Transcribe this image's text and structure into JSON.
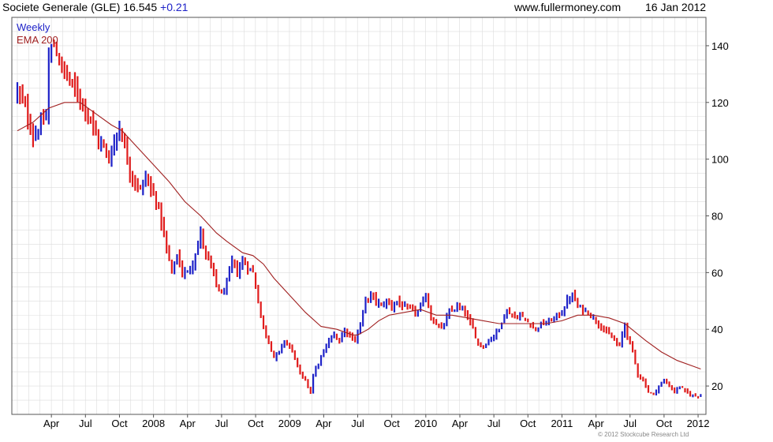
{
  "header": {
    "ticker": "Societe Generale (GLE) 16.545",
    "change": "+0.21",
    "site": "www.fullermoney.com",
    "date": "16 Jan 2012"
  },
  "footer": {
    "copyright": "© 2012 Stockcube Research Ltd"
  },
  "colors": {
    "up": "#1e22c8",
    "down": "#e01b1b",
    "ema": "#a02020",
    "grid": "#dcdcdc",
    "axis": "#555555"
  },
  "chart_data": {
    "type": "candlestick",
    "title": "Societe Generale (GLE) 16.545 +0.21",
    "legend": [
      {
        "name": "Weekly",
        "color": "#1e22c8"
      },
      {
        "name": "EMA 200",
        "color": "#a02020"
      }
    ],
    "legend_position": "top-left",
    "grid": true,
    "y_axis": {
      "side": "right",
      "ylim": [
        10,
        150
      ],
      "ticks": [
        20,
        40,
        60,
        80,
        100,
        120,
        140
      ]
    },
    "x_axis": {
      "labels": [
        "Apr",
        "Jul",
        "Oct",
        "2008",
        "Apr",
        "Jul",
        "Oct",
        "2009",
        "Apr",
        "Jul",
        "Oct",
        "2010",
        "Apr",
        "Jul",
        "Oct",
        "2011",
        "Apr",
        "Jul",
        "Oct",
        "2012"
      ],
      "label_weeks": [
        13,
        26,
        39,
        52,
        65,
        78,
        91,
        104,
        117,
        130,
        143,
        156,
        169,
        182,
        195,
        208,
        221,
        234,
        247,
        260
      ]
    },
    "close_path": [
      [
        0,
        124
      ],
      [
        3,
        118
      ],
      [
        6,
        108
      ],
      [
        9,
        112
      ],
      [
        11,
        115
      ],
      [
        12,
        136
      ],
      [
        14,
        140
      ],
      [
        16,
        135
      ],
      [
        18,
        130
      ],
      [
        20,
        128
      ],
      [
        22,
        124
      ],
      [
        24,
        122
      ],
      [
        26,
        118
      ],
      [
        28,
        114
      ],
      [
        30,
        108
      ],
      [
        33,
        104
      ],
      [
        35,
        100
      ],
      [
        37,
        106
      ],
      [
        39,
        112
      ],
      [
        41,
        104
      ],
      [
        43,
        96
      ],
      [
        45,
        92
      ],
      [
        47,
        89
      ],
      [
        49,
        94
      ],
      [
        51,
        89
      ],
      [
        53,
        86
      ],
      [
        55,
        78
      ],
      [
        57,
        68
      ],
      [
        59,
        60
      ],
      [
        61,
        66
      ],
      [
        63,
        60
      ],
      [
        65,
        60
      ],
      [
        67,
        64
      ],
      [
        69,
        70
      ],
      [
        70,
        74
      ],
      [
        72,
        66
      ],
      [
        74,
        62
      ],
      [
        76,
        56
      ],
      [
        78,
        52
      ],
      [
        80,
        56
      ],
      [
        82,
        64
      ],
      [
        84,
        60
      ],
      [
        86,
        64
      ],
      [
        88,
        62
      ],
      [
        90,
        60
      ],
      [
        92,
        50
      ],
      [
        94,
        40
      ],
      [
        96,
        36
      ],
      [
        98,
        30
      ],
      [
        100,
        32
      ],
      [
        102,
        36
      ],
      [
        104,
        34
      ],
      [
        106,
        30
      ],
      [
        108,
        24
      ],
      [
        110,
        22
      ],
      [
        112,
        18
      ],
      [
        113,
        24
      ],
      [
        115,
        28
      ],
      [
        117,
        32
      ],
      [
        119,
        36
      ],
      [
        121,
        38
      ],
      [
        123,
        36
      ],
      [
        125,
        40
      ],
      [
        127,
        38
      ],
      [
        129,
        36
      ],
      [
        131,
        42
      ],
      [
        133,
        50
      ],
      [
        135,
        52
      ],
      [
        137,
        50
      ],
      [
        139,
        48
      ],
      [
        141,
        50
      ],
      [
        143,
        48
      ],
      [
        145,
        50
      ],
      [
        147,
        48
      ],
      [
        150,
        47
      ],
      [
        153,
        46
      ],
      [
        156,
        52
      ],
      [
        158,
        44
      ],
      [
        160,
        42
      ],
      [
        162,
        40
      ],
      [
        165,
        46
      ],
      [
        168,
        48
      ],
      [
        171,
        46
      ],
      [
        174,
        40
      ],
      [
        176,
        35
      ],
      [
        178,
        34
      ],
      [
        180,
        36
      ],
      [
        182,
        38
      ],
      [
        184,
        40
      ],
      [
        186,
        46
      ],
      [
        188,
        46
      ],
      [
        190,
        44
      ],
      [
        192,
        45
      ],
      [
        194,
        43
      ],
      [
        196,
        42
      ],
      [
        198,
        40
      ],
      [
        200,
        42
      ],
      [
        202,
        42
      ],
      [
        205,
        44
      ],
      [
        208,
        46
      ],
      [
        210,
        50
      ],
      [
        212,
        52
      ],
      [
        214,
        48
      ],
      [
        216,
        47
      ],
      [
        218,
        46
      ],
      [
        220,
        44
      ],
      [
        222,
        42
      ],
      [
        224,
        40
      ],
      [
        226,
        38
      ],
      [
        228,
        36
      ],
      [
        230,
        34
      ],
      [
        232,
        42
      ],
      [
        233,
        38
      ],
      [
        235,
        32
      ],
      [
        237,
        24
      ],
      [
        239,
        22
      ],
      [
        241,
        18
      ],
      [
        243,
        17
      ],
      [
        245,
        20
      ],
      [
        247,
        22
      ],
      [
        249,
        20
      ],
      [
        251,
        18
      ],
      [
        253,
        20
      ],
      [
        255,
        18
      ],
      [
        257,
        17
      ],
      [
        259,
        16.5
      ],
      [
        261,
        16.545
      ]
    ],
    "ema_200": [
      [
        0,
        110
      ],
      [
        6,
        113
      ],
      [
        12,
        118
      ],
      [
        18,
        120
      ],
      [
        24,
        120
      ],
      [
        30,
        116
      ],
      [
        36,
        112
      ],
      [
        40,
        110
      ],
      [
        46,
        104
      ],
      [
        52,
        98
      ],
      [
        58,
        92
      ],
      [
        64,
        85
      ],
      [
        70,
        80
      ],
      [
        76,
        74
      ],
      [
        80,
        71
      ],
      [
        86,
        67
      ],
      [
        90,
        66
      ],
      [
        94,
        63
      ],
      [
        98,
        58
      ],
      [
        104,
        52
      ],
      [
        110,
        46
      ],
      [
        116,
        41
      ],
      [
        122,
        40
      ],
      [
        128,
        38
      ],
      [
        130,
        38
      ],
      [
        134,
        40
      ],
      [
        138,
        43
      ],
      [
        142,
        45
      ],
      [
        148,
        46
      ],
      [
        154,
        47
      ],
      [
        160,
        45
      ],
      [
        166,
        45
      ],
      [
        172,
        44
      ],
      [
        178,
        43
      ],
      [
        184,
        42
      ],
      [
        190,
        42
      ],
      [
        196,
        42
      ],
      [
        202,
        42
      ],
      [
        208,
        43
      ],
      [
        214,
        45
      ],
      [
        220,
        45
      ],
      [
        226,
        44
      ],
      [
        232,
        42
      ],
      [
        236,
        39
      ],
      [
        240,
        36
      ],
      [
        246,
        32
      ],
      [
        252,
        29
      ],
      [
        258,
        27
      ],
      [
        261,
        26
      ]
    ]
  }
}
